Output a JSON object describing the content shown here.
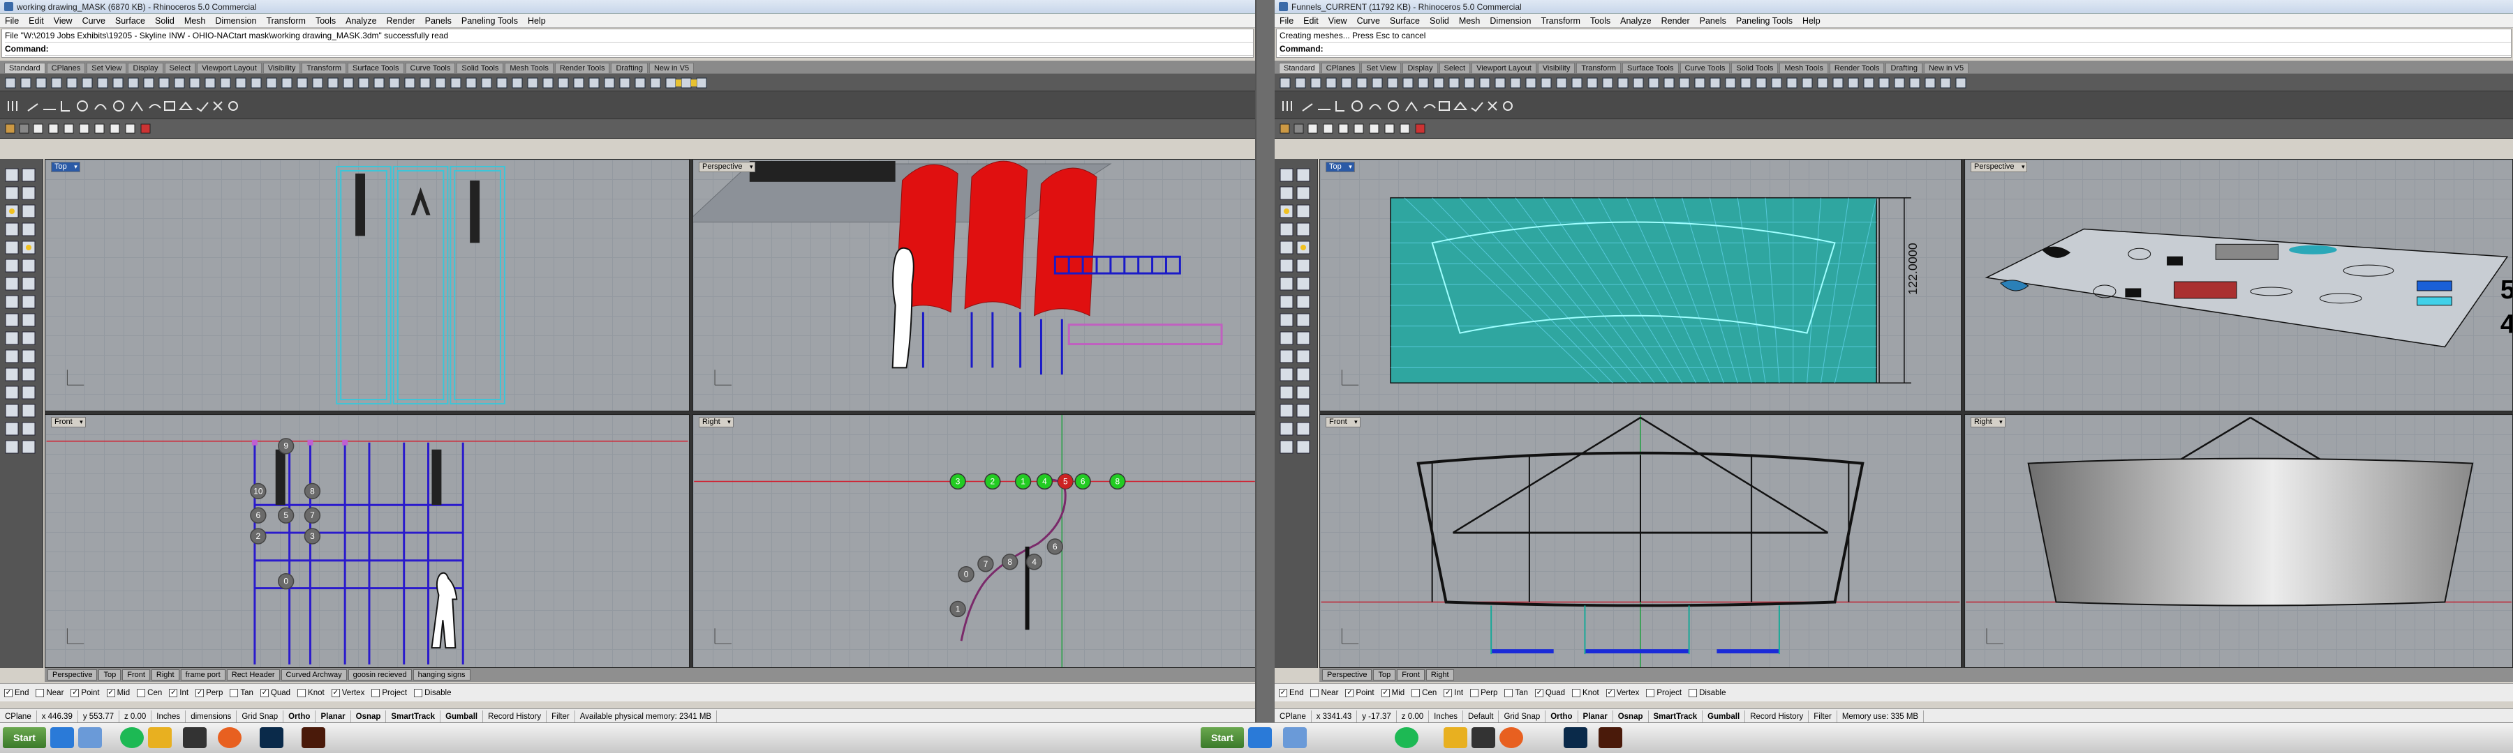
{
  "left": {
    "title": "working drawing_MASK (6870 KB) - Rhinoceros 5.0 Commercial",
    "menu": [
      "File",
      "Edit",
      "View",
      "Curve",
      "Surface",
      "Solid",
      "Mesh",
      "Dimension",
      "Transform",
      "Tools",
      "Analyze",
      "Render",
      "Panels",
      "Paneling Tools",
      "Help"
    ],
    "history_line": "File \"W:\\2019 Jobs Exhibits\\19205 - Skyline INW - OHIO-NACtart mask\\working drawing_MASK.3dm\" successfully read",
    "command_label": "Command:",
    "tabs": [
      "Standard",
      "CPlanes",
      "Set View",
      "Display",
      "Select",
      "Viewport Layout",
      "Visibility",
      "Transform",
      "Surface Tools",
      "Curve Tools",
      "Solid Tools",
      "Mesh Tools",
      "Render Tools",
      "Drafting",
      "New in V5"
    ],
    "viewports": {
      "top": "Top",
      "perspective": "Perspective",
      "front": "Front",
      "right": "Right"
    },
    "bottom_tabs": [
      "Perspective",
      "Top",
      "Front",
      "Right",
      "frame port",
      "Rect Header",
      "Curved Archway",
      "goosin recieved",
      "hanging signs"
    ],
    "osnaps": [
      {
        "label": "End",
        "checked": true
      },
      {
        "label": "Near",
        "checked": false
      },
      {
        "label": "Point",
        "checked": true
      },
      {
        "label": "Mid",
        "checked": true
      },
      {
        "label": "Cen",
        "checked": false
      },
      {
        "label": "Int",
        "checked": true
      },
      {
        "label": "Perp",
        "checked": true
      },
      {
        "label": "Tan",
        "checked": false
      },
      {
        "label": "Quad",
        "checked": true
      },
      {
        "label": "Knot",
        "checked": false
      },
      {
        "label": "Vertex",
        "checked": true
      },
      {
        "label": "Project",
        "checked": false
      },
      {
        "label": "Disable",
        "checked": false
      }
    ],
    "status": {
      "cplane": "CPlane",
      "x": "x 446.39",
      "y": "y 553.77",
      "z": "z 0.00",
      "units": "Inches",
      "layer": "dimensions",
      "grid_snap": "Grid Snap",
      "ortho": "Ortho",
      "planar": "Planar",
      "osnap": "Osnap",
      "smarttrack": "SmartTrack",
      "gumball": "Gumball",
      "record": "Record History",
      "filter": "Filter",
      "memory": "Available physical memory: 2341 MB"
    },
    "markers_gray": [
      "9",
      "10",
      "8",
      "6",
      "5",
      "7",
      "2",
      "3",
      "0",
      "1",
      "7",
      "8",
      "4",
      "6"
    ],
    "markers_green": [
      "3",
      "2",
      "1",
      "4",
      "5",
      "6",
      "8"
    ]
  },
  "right": {
    "title": "Funnels_CURRENT (11792 KB) - Rhinoceros 5.0 Commercial",
    "menu": [
      "File",
      "Edit",
      "View",
      "Curve",
      "Surface",
      "Solid",
      "Mesh",
      "Dimension",
      "Transform",
      "Tools",
      "Analyze",
      "Render",
      "Panels",
      "Paneling Tools",
      "Help"
    ],
    "history_line": "Creating meshes... Press Esc to cancel",
    "command_label": "Command:",
    "tabs": [
      "Standard",
      "CPlanes",
      "Set View",
      "Display",
      "Select",
      "Viewport Layout",
      "Visibility",
      "Transform",
      "Surface Tools",
      "Curve Tools",
      "Solid Tools",
      "Mesh Tools",
      "Render Tools",
      "Drafting",
      "New in V5"
    ],
    "viewports": {
      "top": "Top",
      "perspective": "Perspective",
      "front": "Front",
      "right": "Right"
    },
    "dimension": "122.0000",
    "persp_numbers": [
      "5",
      "4"
    ],
    "bottom_tabs": [
      "Perspective",
      "Top",
      "Front",
      "Right"
    ],
    "osnaps": [
      {
        "label": "End",
        "checked": true
      },
      {
        "label": "Near",
        "checked": false
      },
      {
        "label": "Point",
        "checked": true
      },
      {
        "label": "Mid",
        "checked": true
      },
      {
        "label": "Cen",
        "checked": false
      },
      {
        "label": "Int",
        "checked": true
      },
      {
        "label": "Perp",
        "checked": false
      },
      {
        "label": "Tan",
        "checked": false
      },
      {
        "label": "Quad",
        "checked": true
      },
      {
        "label": "Knot",
        "checked": false
      },
      {
        "label": "Vertex",
        "checked": true
      },
      {
        "label": "Project",
        "checked": false
      },
      {
        "label": "Disable",
        "checked": false
      }
    ],
    "status": {
      "cplane": "CPlane",
      "x": "x 3341.43",
      "y": "y -17.37",
      "z": "z 0.00",
      "units": "Inches",
      "layer": "Default",
      "grid_snap": "Grid Snap",
      "ortho": "Ortho",
      "planar": "Planar",
      "osnap": "Osnap",
      "smarttrack": "SmartTrack",
      "gumball": "Gumball",
      "record": "Record History",
      "filter": "Filter",
      "memory": "Memory use: 335 MB"
    }
  },
  "taskbar": {
    "start": "Start",
    "apps": [
      "edge-icon",
      "explorer-icon",
      "spotify-icon",
      "folder-icon",
      "rhino-icon",
      "firefox-icon",
      "photoshop-icon",
      "illustrator-icon"
    ]
  }
}
